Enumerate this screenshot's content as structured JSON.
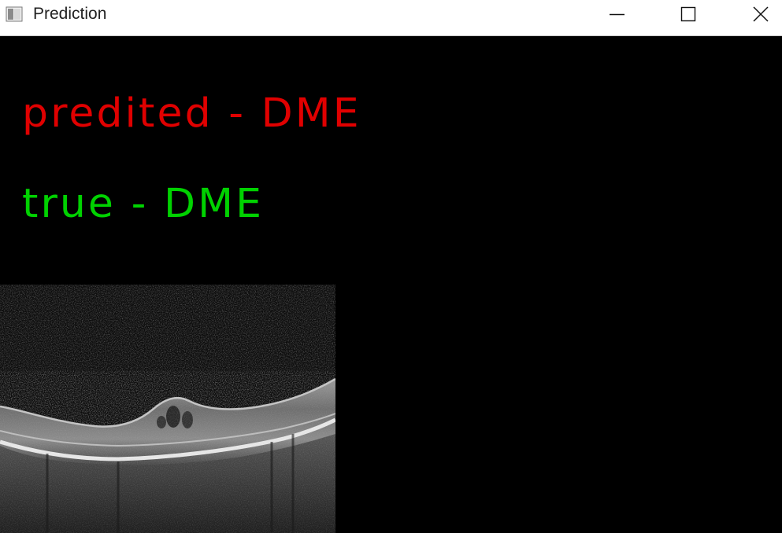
{
  "window": {
    "title": "Prediction",
    "icon": "opencv-window-icon",
    "controls": [
      "minimize-icon",
      "maximize-icon",
      "close-icon"
    ]
  },
  "prediction": {
    "predicted_text": "predited - DME",
    "true_text": "true - DME",
    "predicted_color": "#e00000",
    "true_color": "#00d200"
  },
  "image": {
    "description_icon": "oct-retina-scan",
    "background_color": "#000000"
  }
}
